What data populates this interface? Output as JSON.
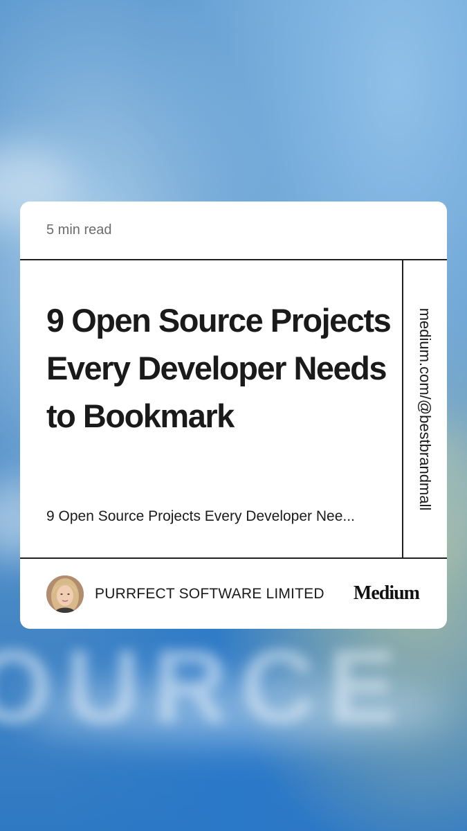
{
  "card": {
    "read_time": "5 min read",
    "title": "9 Open Source Projects Every Developer Needs to Bookmark",
    "subtitle": "9 Open Source Projects Every Developer Nee...",
    "side_url": "medium.com/@bestbrandmall",
    "author": "PURRFECT SOFTWARE LIMITED",
    "brand": "Medium"
  },
  "background": {
    "blurred_word": "OURCE"
  },
  "colors": {
    "card_background": "#ffffff",
    "text_primary": "#1a1a1a",
    "text_muted": "#6b6b6b",
    "rule": "#1f1f1f",
    "background_blue": "#4f8fc6"
  },
  "icons": {
    "avatar": "author-avatar-photo"
  }
}
